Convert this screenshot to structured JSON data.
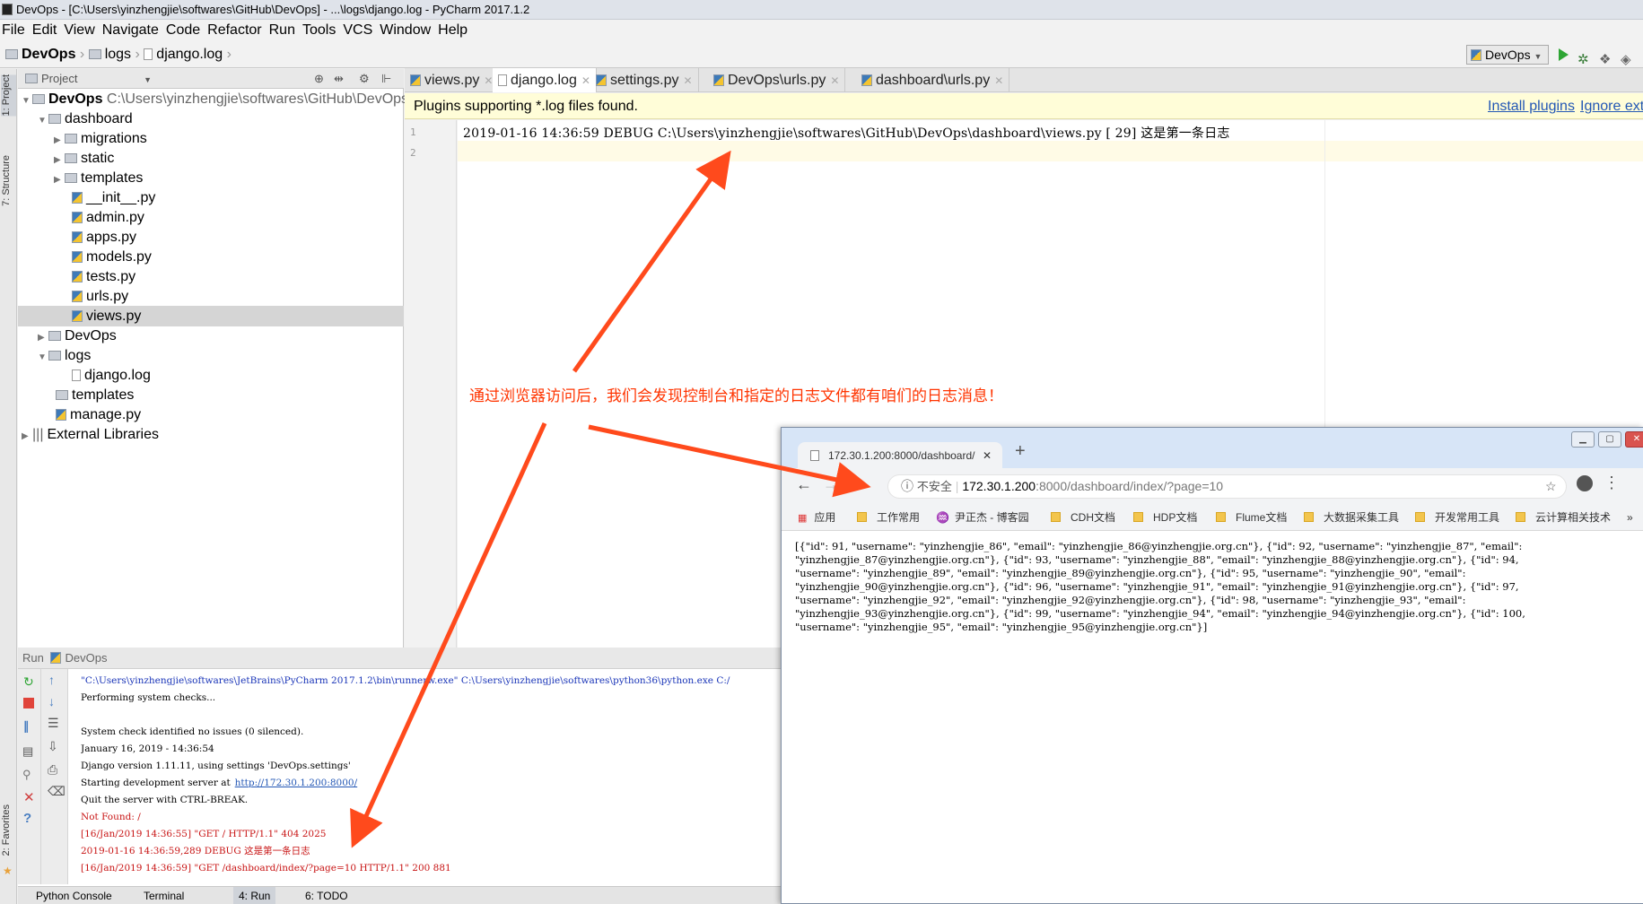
{
  "window": {
    "title": "DevOps - [C:\\Users\\yinzhengjie\\softwares\\GitHub\\DevOps] - ...\\logs\\django.log - PyCharm 2017.1.2"
  },
  "menu": [
    "File",
    "Edit",
    "View",
    "Navigate",
    "Code",
    "Refactor",
    "Run",
    "Tools",
    "VCS",
    "Window",
    "Help"
  ],
  "breadcrumb": {
    "root": "DevOps",
    "folder": "logs",
    "file": "django.log"
  },
  "run_config": {
    "label": "DevOps"
  },
  "side_tabs": {
    "project": "1: Project",
    "structure": "7: Structure",
    "favorites": "2: Favorites"
  },
  "project": {
    "header": "Project",
    "root": {
      "label": "DevOps",
      "path": "C:\\Users\\yinzhengjie\\softwares\\GitHub\\DevOps"
    },
    "items": [
      "dashboard",
      "migrations",
      "static",
      "templates",
      "__init__.py",
      "admin.py",
      "apps.py",
      "models.py",
      "tests.py",
      "urls.py",
      "views.py",
      "DevOps",
      "logs",
      "django.log",
      "templates",
      "manage.py",
      "External Libraries"
    ]
  },
  "editor": {
    "tabs": [
      "views.py",
      "django.log",
      "settings.py",
      "DevOps\\urls.py",
      "dashboard\\urls.py"
    ],
    "active_tab": "django.log",
    "banner": {
      "text": "Plugins supporting *.log files found.",
      "install": "Install plugins",
      "ignore": "Ignore ext"
    },
    "line_numbers": [
      "1",
      "2"
    ],
    "lines": [
      "2019-01-16 14:36:59 DEBUG  C:\\Users\\yinzhengjie\\softwares\\GitHub\\DevOps\\dashboard\\views.py [ 29] 这是第一条日志",
      ""
    ]
  },
  "run": {
    "header": "Run",
    "config": "DevOps",
    "console": [
      {
        "text": "\"C:\\Users\\yinzhengjie\\softwares\\JetBrains\\PyCharm 2017.1.2\\bin\\runnerw.exe\" C:\\Users\\yinzhengjie\\softwares\\python36\\python.exe C:/",
        "color": "#1a35b8"
      },
      {
        "text": "Performing system checks...",
        "color": "#000"
      },
      {
        "text": "",
        "color": "#000"
      },
      {
        "text": "System check identified no issues (0 silenced).",
        "color": "#000"
      },
      {
        "text": "January 16, 2019 - 14:36:54",
        "color": "#000"
      },
      {
        "text": "Django version 1.11.11, using settings 'DevOps.settings'",
        "color": "#000"
      },
      {
        "text": "Starting development server at",
        "color": "#000",
        "link": "http://172.30.1.200:8000/"
      },
      {
        "text": "Quit the server with CTRL-BREAK.",
        "color": "#000"
      },
      {
        "text": "Not Found: /",
        "color": "#c81414"
      },
      {
        "text": "[16/Jan/2019 14:36:55] \"GET / HTTP/1.1\" 404 2025",
        "color": "#c81414"
      },
      {
        "text": "2019-01-16 14:36:59,289 DEBUG 这是第一条日志",
        "color": "#c81414"
      },
      {
        "text": "[16/Jan/2019 14:36:59] \"GET /dashboard/index/?page=10 HTTP/1.1\" 200 881",
        "color": "#c81414"
      }
    ]
  },
  "bottom_tabs": [
    "Python Console",
    "Terminal",
    "4: Run",
    "6: TODO"
  ],
  "annotation": "通过浏览器访问后，我们会发现控制台和指定的日志文件都有咱们的日志消息！",
  "browser": {
    "tab_title": "172.30.1.200:8000/dashboard/",
    "security": "不安全",
    "url_host": "172.30.1.200",
    "url_rest": ":8000/dashboard/index/?page=10",
    "bookmarks": [
      "应用",
      "工作常用",
      "尹正杰 - 博客园",
      "CDH文档",
      "HDP文档",
      "Flume文档",
      "大数据采集工具",
      "开发常用工具",
      "云计算相关技术"
    ],
    "more": "»",
    "body": "[{\"id\": 91, \"username\": \"yinzhengjie_86\", \"email\": \"yinzhengjie_86@yinzhengjie.org.cn\"}, {\"id\": 92, \"username\": \"yinzhengjie_87\", \"email\":\n\"yinzhengjie_87@yinzhengjie.org.cn\"}, {\"id\": 93, \"username\": \"yinzhengjie_88\", \"email\": \"yinzhengjie_88@yinzhengjie.org.cn\"}, {\"id\": 94,\n\"username\": \"yinzhengjie_89\", \"email\": \"yinzhengjie_89@yinzhengjie.org.cn\"}, {\"id\": 95, \"username\": \"yinzhengjie_90\", \"email\":\n\"yinzhengjie_90@yinzhengjie.org.cn\"}, {\"id\": 96, \"username\": \"yinzhengjie_91\", \"email\": \"yinzhengjie_91@yinzhengjie.org.cn\"}, {\"id\": 97,\n\"username\": \"yinzhengjie_92\", \"email\": \"yinzhengjie_92@yinzhengjie.org.cn\"}, {\"id\": 98, \"username\": \"yinzhengjie_93\", \"email\":\n\"yinzhengjie_93@yinzhengjie.org.cn\"}, {\"id\": 99, \"username\": \"yinzhengjie_94\", \"email\": \"yinzhengjie_94@yinzhengjie.org.cn\"}, {\"id\": 100,\n\"username\": \"yinzhengjie_95\", \"email\": \"yinzhengjie_95@yinzhengjie.org.cn\"}]"
  },
  "colors": {
    "annotation": "#ff3400",
    "link": "#2357b5",
    "banner_bg": "#fffdd8",
    "selection": "#d5d5d5"
  }
}
